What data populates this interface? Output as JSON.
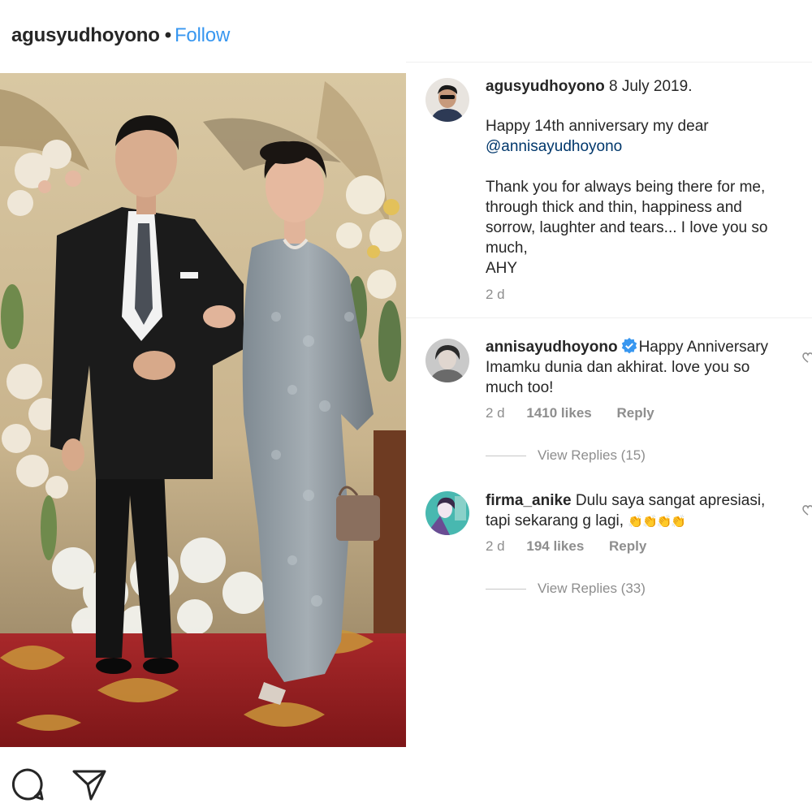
{
  "header": {
    "username": "agusyudhoyono",
    "separator": "•",
    "follow_label": "Follow"
  },
  "caption": {
    "username": "agusyudhoyono",
    "date": "8 July 2019.",
    "line1": "Happy 14th anniversary my dear",
    "mention": "@annisayudhoyono",
    "line2": "Thank you for always being there for me,",
    "line3": "through thick and thin, happiness and",
    "line4": "sorrow, laughter and tears... I love you so",
    "line5": "much,",
    "line6": "AHY",
    "time": "2 d"
  },
  "comments": [
    {
      "username": "annisayudhoyono",
      "verified": true,
      "line1": "Happy Anniversary",
      "line2": "Imamku dunia dan akhirat. love you so",
      "line3": "much too!",
      "time": "2 d",
      "likes": "1410 likes",
      "reply": "Reply",
      "view_replies": "View Replies (15)"
    },
    {
      "username": "firma_anike",
      "verified": false,
      "line1": "Dulu saya sangat apresiasi,",
      "line2": "tapi sekarang g lagi,",
      "emoji": "👏👏👏👏",
      "time": "2 d",
      "likes": "194 likes",
      "reply": "Reply",
      "view_replies": "View Replies (33)"
    }
  ],
  "actions": {
    "comment_icon": "comment-icon",
    "share_icon": "share-icon"
  },
  "colors": {
    "link_blue": "#3897f0",
    "mention": "#00376b",
    "meta_gray": "#8e8e8e",
    "verified_blue": "#3897f0"
  }
}
